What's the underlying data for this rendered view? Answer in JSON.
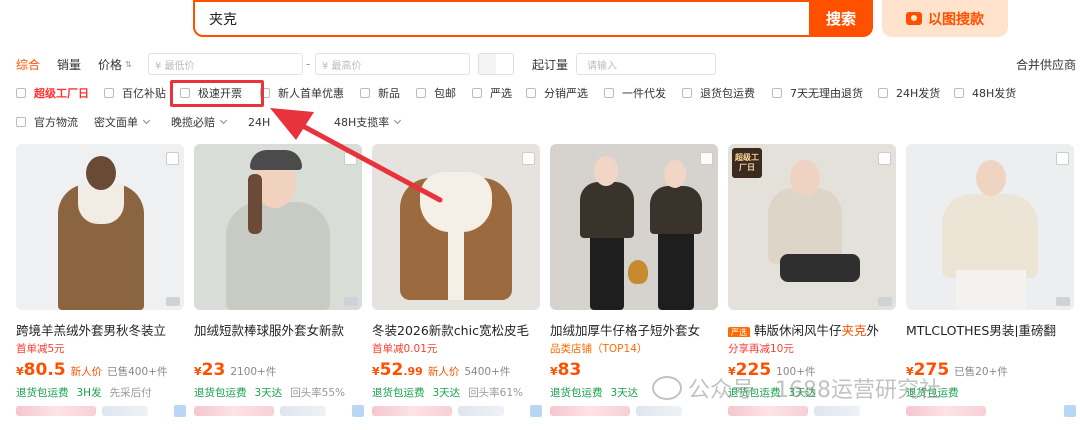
{
  "search": {
    "query": "夹克",
    "button": "搜索",
    "image_search": "以图搜款"
  },
  "sort": {
    "items": [
      "综合",
      "销量",
      "价格"
    ],
    "price_min_placeholder": "¥ 最低价",
    "price_sep": "-",
    "price_max_placeholder": "¥ 最高价",
    "min_order_label": "起订量",
    "min_order_placeholder": "请输入",
    "merge_supplier": "合并供应商"
  },
  "filters_row1": [
    "超级工厂日",
    "百亿补贴",
    "极速开票",
    "新人首单优惠",
    "新品",
    "包邮",
    "严选",
    "分销严选",
    "一件代发",
    "退货包运费",
    "7天无理由退货",
    "24H发货",
    "48H发货"
  ],
  "filters_row2": [
    "官方物流",
    "密文面单",
    "晚揽必赔",
    "24H",
    "48H支揽率"
  ],
  "products": [
    {
      "title": "跨境羊羔绒外套男秋冬装立",
      "promo": "首单减5元",
      "currency": "¥",
      "price": "80.5",
      "price_note": "新人价",
      "sold": "已售400+件",
      "services": [
        "退货包运费",
        "3H发"
      ],
      "services_gray": [
        "先采后付"
      ],
      "colors": {
        "bg": "#eef0f2",
        "coat": "#8b6440",
        "pants": "#2d2d2d",
        "skin": "#6b4a35"
      }
    },
    {
      "title": "加绒短款棒球服外套女新款",
      "promo": "",
      "currency": "¥",
      "price": "23",
      "price_note": "",
      "sold": "2100+件",
      "services": [
        "退货包运费",
        "3天达"
      ],
      "services_gray": [
        "回头率55%"
      ],
      "colors": {
        "bg": "#d9ddd7",
        "coat": "#c7cbc4",
        "pants": "#3b3b3b",
        "skin": "#f0d2bf"
      }
    },
    {
      "title": "冬装2026新款chic宽松皮毛",
      "promo": "首单减0.01元",
      "currency": "¥",
      "price": "52",
      "price_decimal": ".99",
      "price_note": "新人价",
      "sold": "5400+件",
      "services": [
        "退货包运费",
        "3天达"
      ],
      "services_gray": [
        "回头率61%"
      ],
      "colors": {
        "bg": "#e6e2dd",
        "coat": "#9c6a3f",
        "pants": "#f4efe7",
        "skin": "#f2f0ec"
      }
    },
    {
      "title": "加绒加厚牛仔格子短外套女",
      "promo": "品类店铺（TOP14）",
      "currency": "¥",
      "price": "83",
      "price_note": "",
      "sold": "",
      "services": [
        "退货包运费",
        "3天达"
      ],
      "services_gray": [],
      "colors": {
        "bg": "#d6d3cf",
        "coat": "#3a332c",
        "pants": "#1e1e1e",
        "skin": "#f1d6c6"
      }
    },
    {
      "badge": "超级工厂日",
      "title_prefix": "韩版休闲风牛仔",
      "title_kw": "夹克",
      "title_suffix": "外",
      "promo_badge": "严选",
      "promo": "分享再减10元",
      "currency": "¥",
      "price": "225",
      "price_note": "",
      "sold": "100+件",
      "services": [
        "退货包运费",
        "3天达"
      ],
      "services_gray": [],
      "colors": {
        "bg": "#e4e0da",
        "coat": "#ddd6c8",
        "pants": "#2f2f2f",
        "skin": "#efd3c2"
      }
    },
    {
      "title": "MTLCLOTHES男装|重磅翻",
      "promo": "",
      "currency": "¥",
      "price": "275",
      "price_note": "",
      "sold": "已售20+件",
      "services": [
        "退货包运费"
      ],
      "services_gray": [],
      "colors": {
        "bg": "#eceef0",
        "coat": "#ece5d6",
        "pants": "#f4f2ee",
        "skin": "#f0d4c2"
      }
    }
  ],
  "watermark": "公众号 · 1688运营研究社",
  "colors": {
    "accent": "#ff5000",
    "highlight": "#e8323c",
    "green": "#16a34a"
  }
}
